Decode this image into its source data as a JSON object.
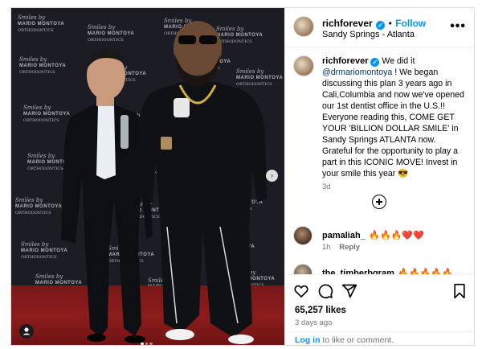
{
  "photo": {
    "backdrop_logo_line1": "Smiles by",
    "backdrop_logo_line2": "MARIO MONTOYA",
    "backdrop_logo_line3": "ORTHODONTICS",
    "next_arrow": "›",
    "carousel_count": 3,
    "carousel_active": 1
  },
  "header": {
    "username": "richforever",
    "separator": "•",
    "follow_label": "Follow",
    "location": "Sandy Springs - Atlanta",
    "more_icon": "•••"
  },
  "caption": {
    "username": "richforever",
    "text_start": "We did it",
    "mention": "@drmariomontoya",
    "text_body": "! We began discussing this plan 3 years ago in Cali,Columbia and now we've opened our 1st dentist office in the U.S.!! Everyone reading this, COME GET YOUR 'BILLION DOLLAR SMILE' in Sandy Springs ATLANTA now. Grateful for the opportunity to play a part in this ICONIC MOVE! Invest in your smile this year 😎",
    "age": "3d"
  },
  "comments": [
    {
      "username": "pamaliah_",
      "text": "🔥🔥🔥❤️❤️",
      "age": "1h",
      "reply_label": "Reply"
    },
    {
      "username": "the_timberbgram",
      "text": "🔥🔥🔥🔥🔥"
    }
  ],
  "actions": {
    "likes": "65,257 likes",
    "time_ago": "3 days ago",
    "login_link": "Log in",
    "login_text": "to like or comment."
  },
  "colors": {
    "accent": "#0095f6",
    "verified": "#0095f6",
    "muted": "#737373",
    "carpet": "#8c1c1c"
  }
}
